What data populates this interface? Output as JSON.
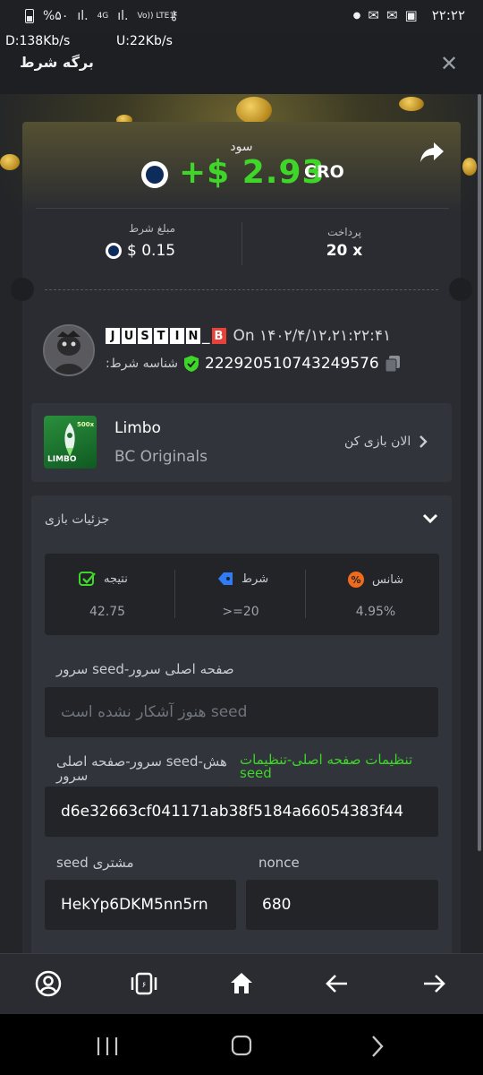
{
  "status_bar": {
    "battery": "%۵۰",
    "network_4g": "4G",
    "volte": "Vo)) LTE1",
    "time": "۲۲:۲۲",
    "download_speed": "D:138Kb/s",
    "upload_speed": "U:22Kb/s"
  },
  "header": {
    "title": "برگه شرط",
    "close": "✕"
  },
  "bet_card": {
    "profit_label": "سود",
    "profit_amount": "+$ 2.93",
    "profit_currency": "CRO",
    "bet_amount_label": "مبلغ شرط",
    "bet_amount_value": "$ 0.15",
    "payout_label": "پرداخت",
    "payout_value": "20 x"
  },
  "user": {
    "name_letters": [
      "J",
      "U",
      "S",
      "T",
      "I",
      "N",
      "_",
      "B"
    ],
    "on_text": "On ۱۴۰۲/۴/۱۲،۲۱:۲۲:۴۱",
    "bet_id_label": ":شناسه شرط",
    "bet_id": "222920510743249576"
  },
  "game": {
    "name": "Limbo",
    "provider": "BC Originals",
    "play_now": "الان بازی کن",
    "thumb_label": "LIMBO",
    "thumb_badge": "500x"
  },
  "details": {
    "title": "جزئیات بازی",
    "stats": [
      {
        "label": "نتیجه",
        "value": "42.75",
        "icon": "check-icon",
        "color": "#3fd62a"
      },
      {
        "label": "شرط",
        "value": ">=20",
        "icon": "tag-icon",
        "color": "#2f7cf6"
      },
      {
        "label": "شانس",
        "value": "4.95%",
        "icon": "percent-icon",
        "color": "#f06a1c"
      }
    ],
    "server_seed_label": "سرور seed-صفحه اصلی سرور",
    "server_seed_placeholder": "هنوز آشکار نشده است seed",
    "hash_label": "سرور-صفحه اصلی seed-هش سرور",
    "hash_link": "تنظیمات صفحه اصلی-تنظیمات seed",
    "hash_value": "d6e32663cf041171ab38f5184a66054383f44",
    "client_seed_label": "seed مشتری",
    "client_seed_value": "HekYp6DKM5nn5rn",
    "nonce_label": "nonce",
    "nonce_value": "680"
  },
  "colors": {
    "accent_green": "#3fd62a",
    "background": "#1d1f23",
    "card": "#2a2c31"
  }
}
